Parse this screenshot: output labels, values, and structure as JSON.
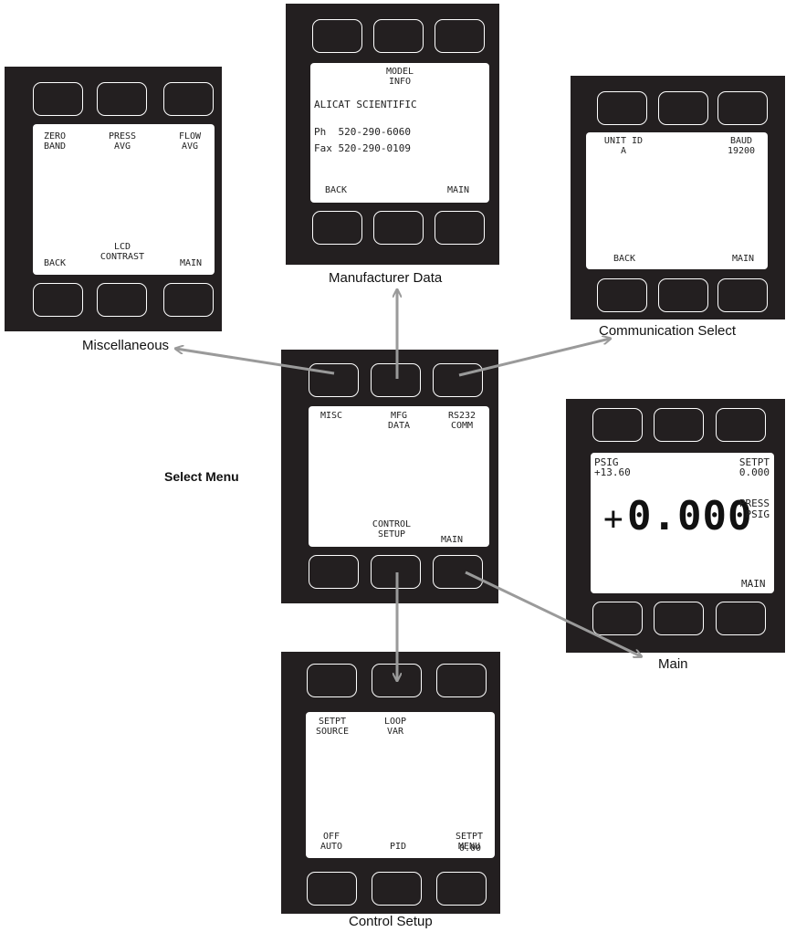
{
  "captions": {
    "misc": "Miscellaneous",
    "mfg": "Manufacturer Data",
    "comm": "Communication Select",
    "select": "Select Menu",
    "main": "Main",
    "control": "Control Setup"
  },
  "misc_screen": {
    "top_left": "ZERO\nBAND",
    "top_mid": "PRESS\nAVG",
    "top_right": "FLOW\nAVG",
    "bottom_left": "BACK",
    "bottom_mid": "LCD\nCONTRAST",
    "bottom_right": "MAIN"
  },
  "mfg_screen": {
    "title": "MODEL\nINFO",
    "company": "ALICAT SCIENTIFIC",
    "phone": "Ph  520-290-6060",
    "fax": "Fax 520-290-0109",
    "bottom_left": "BACK",
    "bottom_right": "MAIN"
  },
  "comm_screen": {
    "top_left": "UNIT ID\nA",
    "top_right": "BAUD\n19200",
    "bottom_left": "BACK",
    "bottom_right": "MAIN"
  },
  "select_screen": {
    "top_left": "MISC",
    "top_mid": "MFG\nDATA",
    "top_right": "RS232\nCOMM",
    "bottom_mid": "CONTROL\nSETUP",
    "bottom_right": "MAIN"
  },
  "main_screen": {
    "top_left": "PSIG\n+13.60",
    "top_right": "SETPT\n0.000",
    "sign": "+",
    "value": "0.000",
    "unit": "PRESS\nPSIG",
    "bottom_right": "MAIN"
  },
  "control_screen": {
    "top_left": "SETPT\nSOURCE",
    "top_mid": "LOOP\nVAR",
    "bottom_left": "OFF\nAUTO",
    "bottom_mid": "PID",
    "bottom_right": "SETPT\nMENU",
    "bottom_right_overlay": "0.00"
  },
  "colors": {
    "device": "#231f20",
    "arrow": "#9a9a9a"
  }
}
